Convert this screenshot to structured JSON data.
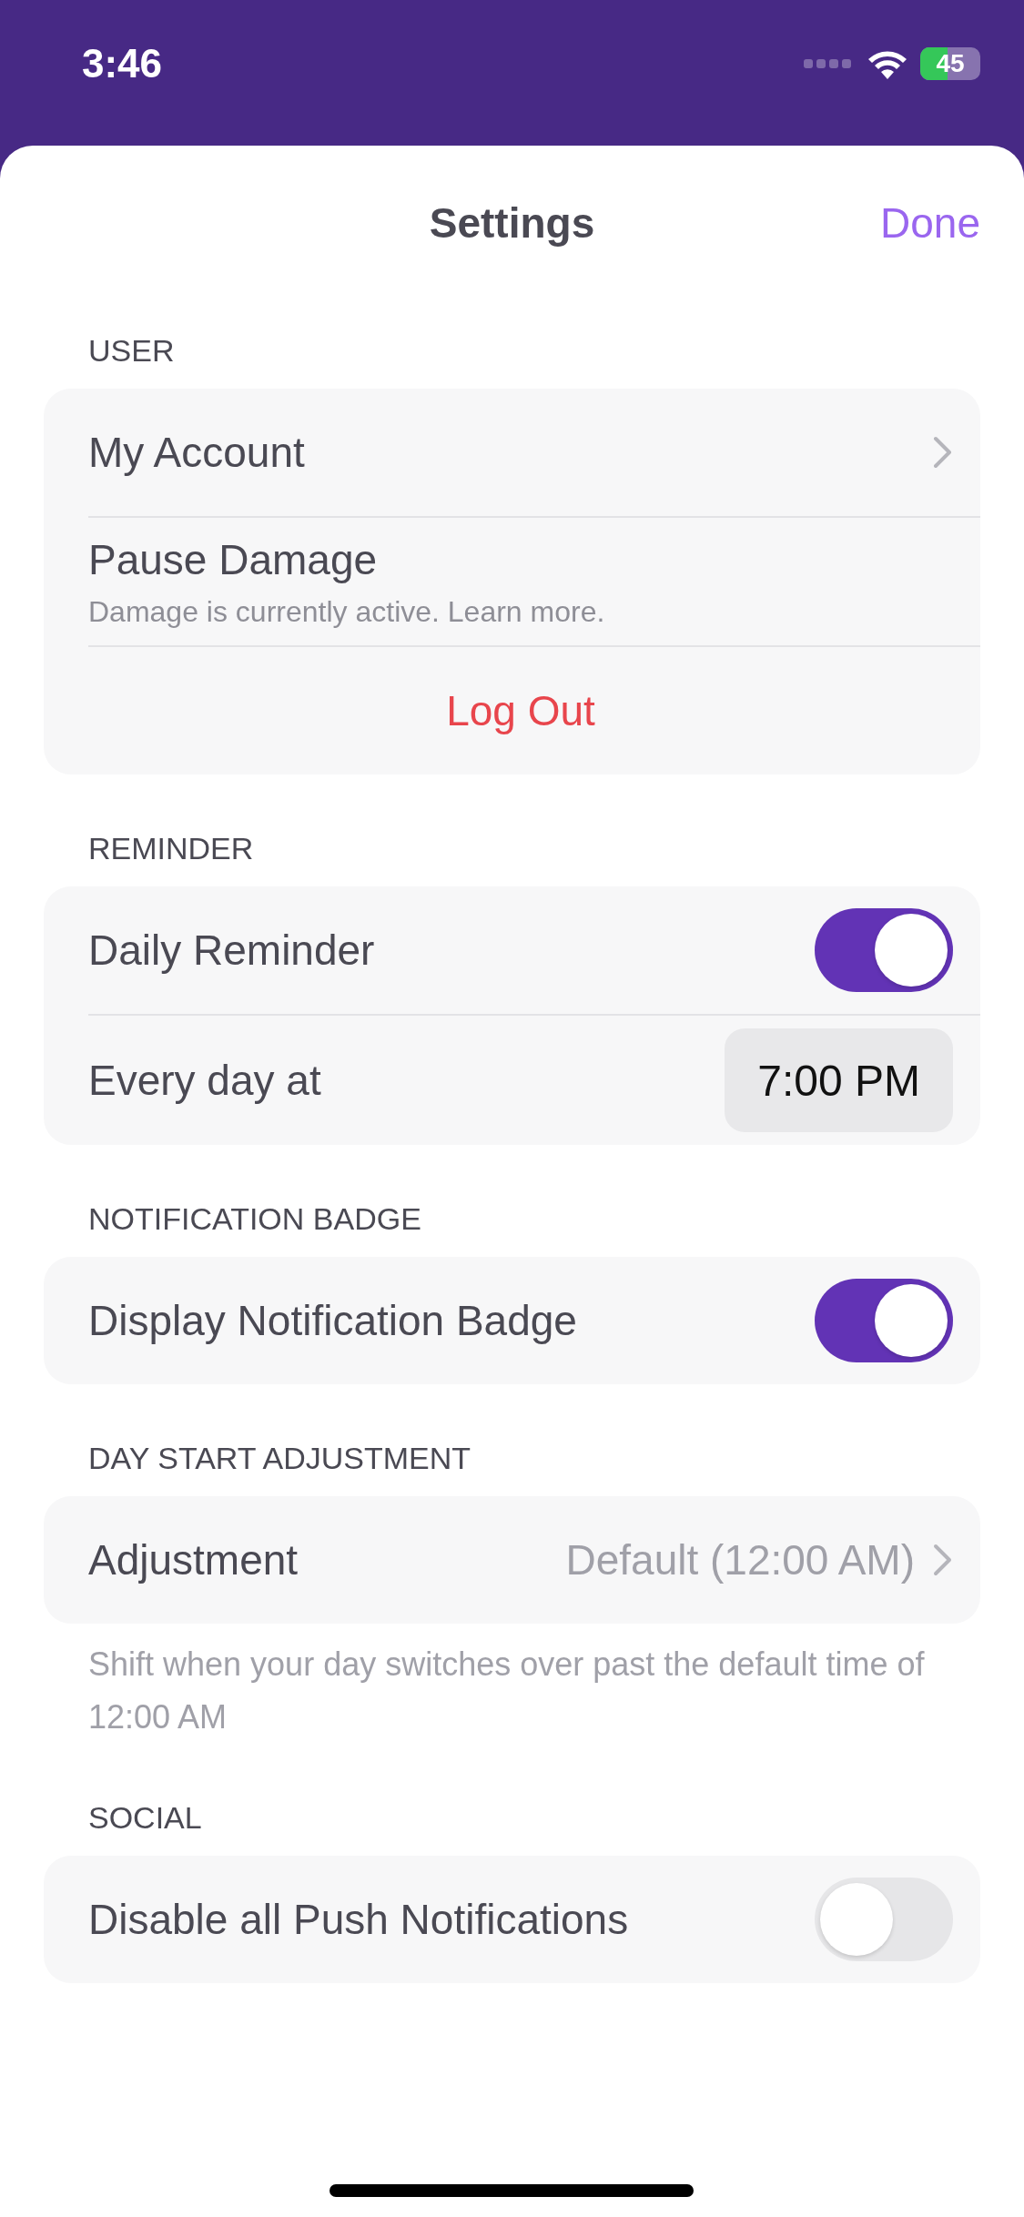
{
  "status_bar": {
    "time": "3:46",
    "battery": "45"
  },
  "header": {
    "title": "Settings",
    "done": "Done"
  },
  "sections": [
    {
      "title": "USER",
      "rows": [
        {
          "kind": "link",
          "label": "My Account"
        },
        {
          "kind": "info",
          "label": "Pause Damage",
          "subtitle": "Damage is currently active. Learn more."
        },
        {
          "kind": "action",
          "label": "Log Out"
        }
      ]
    },
    {
      "title": "REMINDER",
      "rows": [
        {
          "kind": "toggle",
          "label": "Daily Reminder",
          "on": true
        },
        {
          "kind": "time",
          "label": "Every day at",
          "value": "7:00 PM"
        }
      ]
    },
    {
      "title": "NOTIFICATION BADGE",
      "rows": [
        {
          "kind": "toggle",
          "label": "Display Notification Badge",
          "on": true
        }
      ]
    },
    {
      "title": "DAY START ADJUSTMENT",
      "rows": [
        {
          "kind": "link",
          "label": "Adjustment",
          "value": "Default (12:00 AM)"
        }
      ],
      "footer": "Shift when your day switches over past the default time of 12:00 AM"
    },
    {
      "title": "SOCIAL",
      "rows": [
        {
          "kind": "toggle",
          "label": "Disable all Push Notifications",
          "on": false
        }
      ]
    }
  ]
}
